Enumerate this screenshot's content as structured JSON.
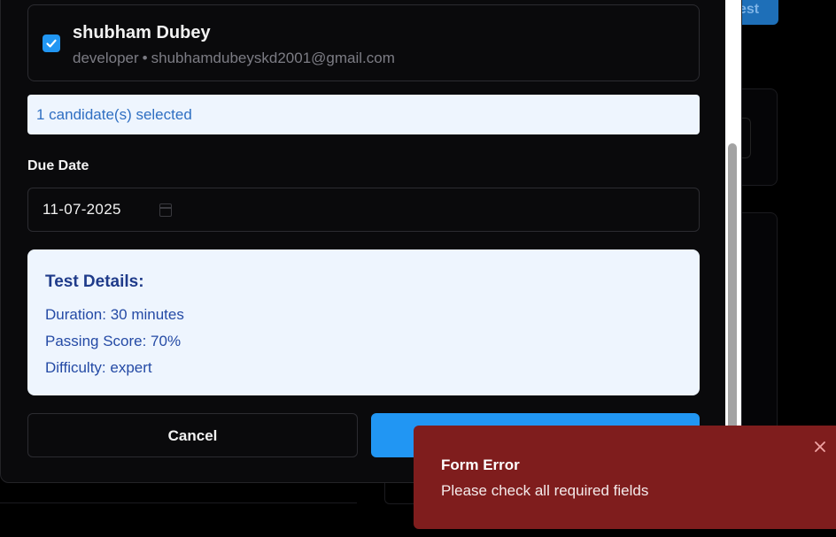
{
  "background": {
    "button_label": "est"
  },
  "candidate": {
    "checked": true,
    "name": "shubham Dubey",
    "role": "developer",
    "separator": "•",
    "email": "shubhamdubeyskd2001@gmail.com"
  },
  "selection": {
    "summary": "1 candidate(s) selected"
  },
  "due_date": {
    "label": "Due Date",
    "value": "11-07-2025"
  },
  "test_details": {
    "title": "Test Details:",
    "duration": "Duration: 30 minutes",
    "passing_score": "Passing Score: 70%",
    "difficulty": "Difficulty: expert"
  },
  "actions": {
    "cancel_label": "Cancel",
    "primary_label": ""
  },
  "toast": {
    "title": "Form Error",
    "message": "Please check all required fields",
    "close_icon": "close-icon"
  },
  "colors": {
    "accent": "#2196f3",
    "info_bg": "#eef5fe",
    "info_text": "#244aa5",
    "error_bg": "#7f1d1d",
    "page_bg": "#000000"
  }
}
